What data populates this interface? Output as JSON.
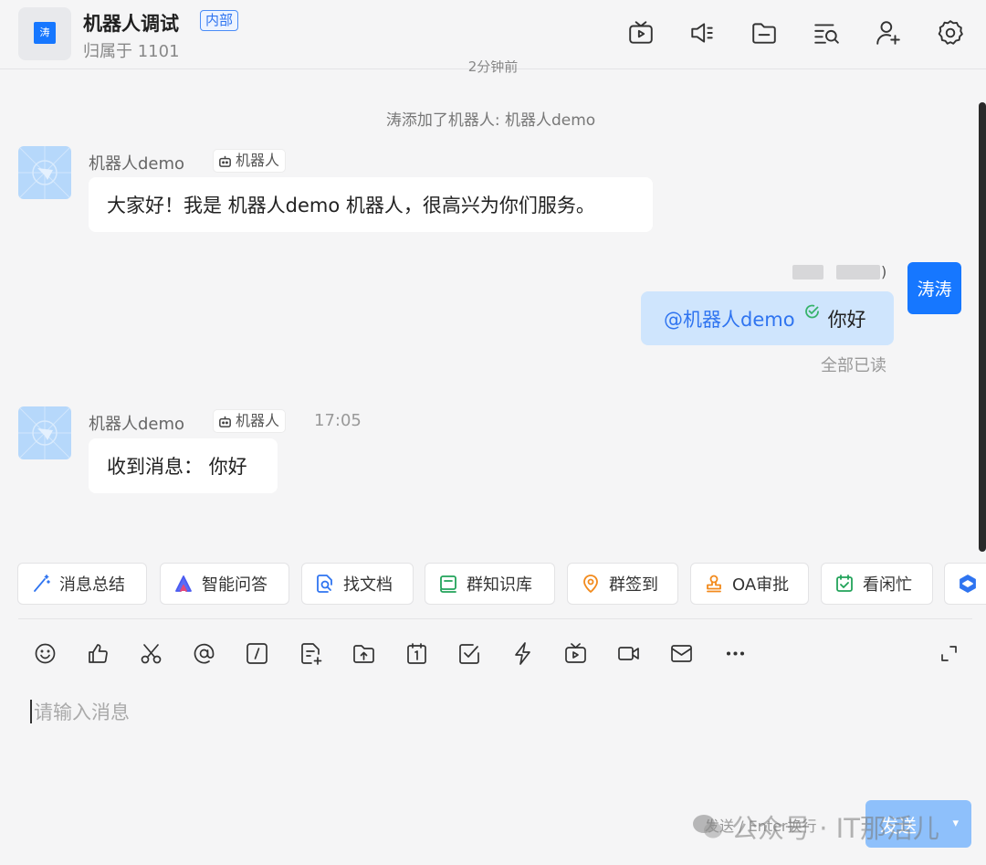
{
  "header": {
    "avatar_char": "涛",
    "title": "机器人调试",
    "badge": "内部",
    "subtitle": "归属于 1101"
  },
  "chat": {
    "time_partial": "2分钟前",
    "system_message": "涛添加了机器人: 机器人demo",
    "messages": [
      {
        "sender": "机器人demo",
        "tag": "机器人",
        "time": "",
        "text": "大家好！我是 机器人demo 机器人，很高兴为你们服务。"
      },
      {
        "sender": "机器人demo",
        "tag": "机器人",
        "time": "17:05",
        "text": "收到消息： 你好"
      }
    ],
    "mine": {
      "name_suffix": ")",
      "avatar_text": "涛涛",
      "mention": "@机器人demo",
      "text": "你好",
      "read_status": "全部已读"
    }
  },
  "quick_actions": [
    "消息总结",
    "智能问答",
    "找文档",
    "群知识库",
    "群签到",
    "OA审批",
    "看闲忙"
  ],
  "input": {
    "placeholder": "请输入消息",
    "send_hint": "发送 / Enter换行",
    "send_label": "发送"
  },
  "watermark": {
    "text": "公众号 · IT那活儿"
  },
  "colors": {
    "accent": "#1677ff",
    "my_bubble": "#cfe5fd",
    "read_check": "#37b36b",
    "send_button": "#8ec0fb"
  }
}
